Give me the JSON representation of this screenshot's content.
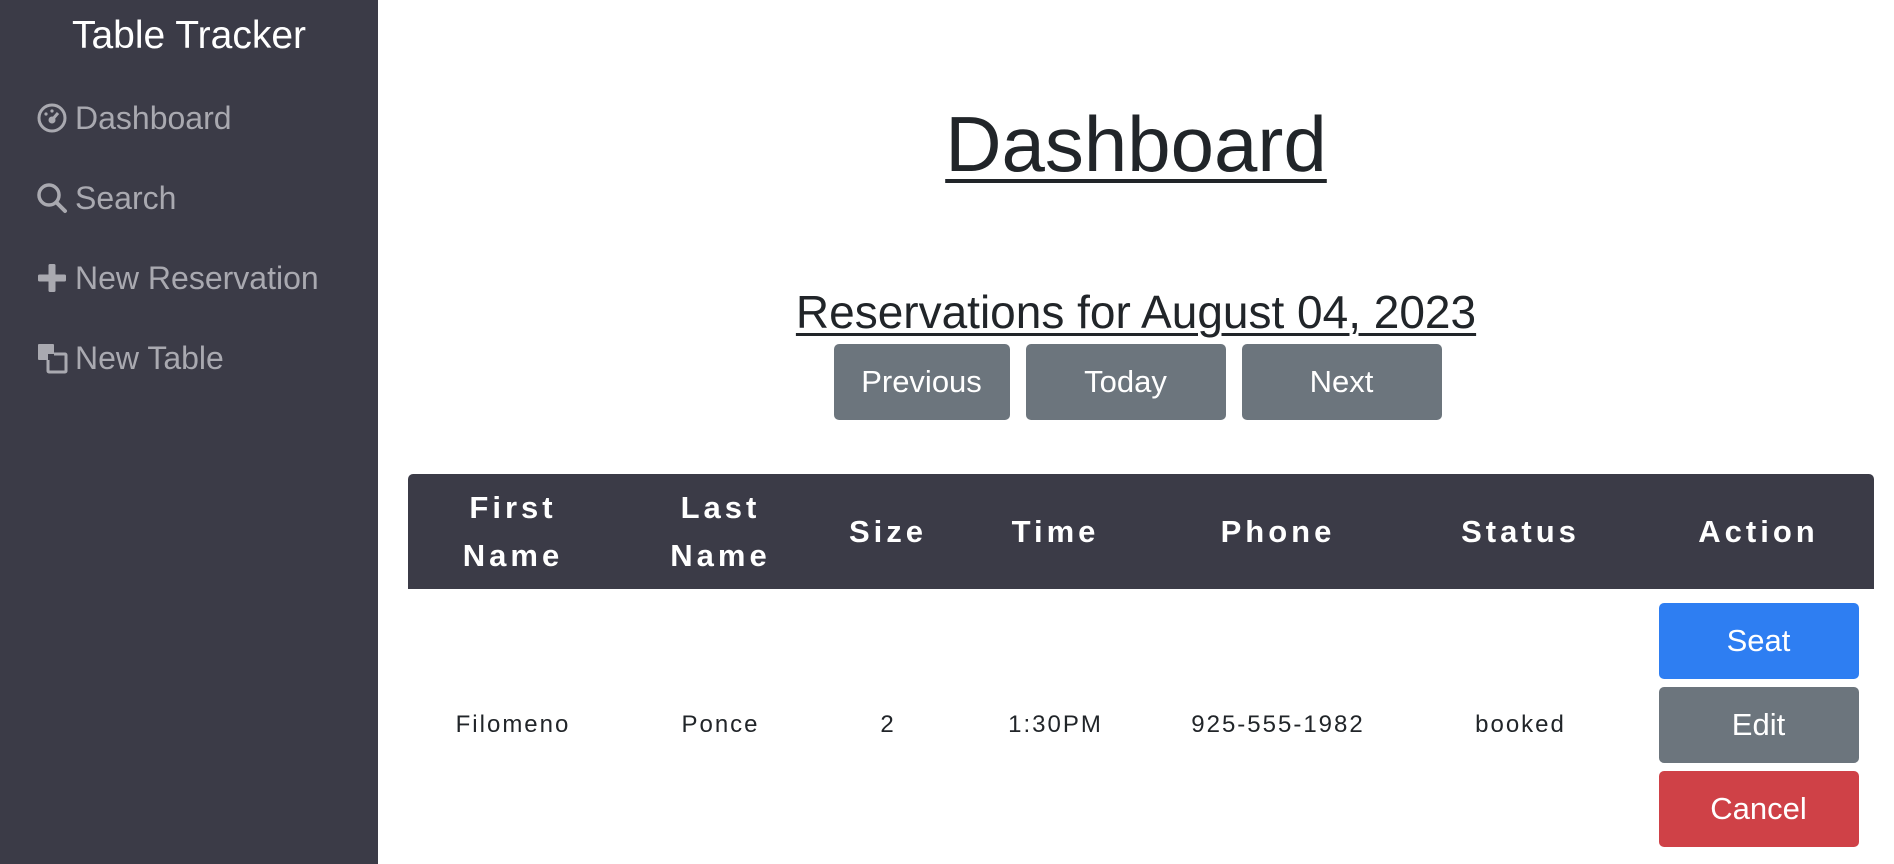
{
  "sidebar": {
    "brand": "Table Tracker",
    "items": [
      {
        "label": "Dashboard",
        "icon": "dashboard-icon"
      },
      {
        "label": "Search",
        "icon": "search-icon"
      },
      {
        "label": "New Reservation",
        "icon": "plus-icon"
      },
      {
        "label": "New Table",
        "icon": "new-table-icon"
      }
    ]
  },
  "main": {
    "title": "Dashboard",
    "date_heading": "Reservations for August 04, 2023",
    "buttons": {
      "previous": "Previous",
      "today": "Today",
      "next": "Next"
    },
    "table": {
      "headers": [
        "First Name",
        "Last Name",
        "Size",
        "Time",
        "Phone",
        "Status",
        "Action"
      ],
      "rows": [
        {
          "first_name": "Filomeno",
          "last_name": "Ponce",
          "size": "2",
          "time": "1:30PM",
          "phone": "925-555-1982",
          "status": "booked",
          "actions": {
            "seat": "Seat",
            "edit": "Edit",
            "cancel": "Cancel"
          }
        }
      ]
    }
  },
  "colors": {
    "sidebar_bg": "#3b3b47",
    "nav_text": "#a9a9b0",
    "button_gray": "#6c757d",
    "button_blue": "#2e7ef2",
    "button_red": "#cf4147"
  }
}
